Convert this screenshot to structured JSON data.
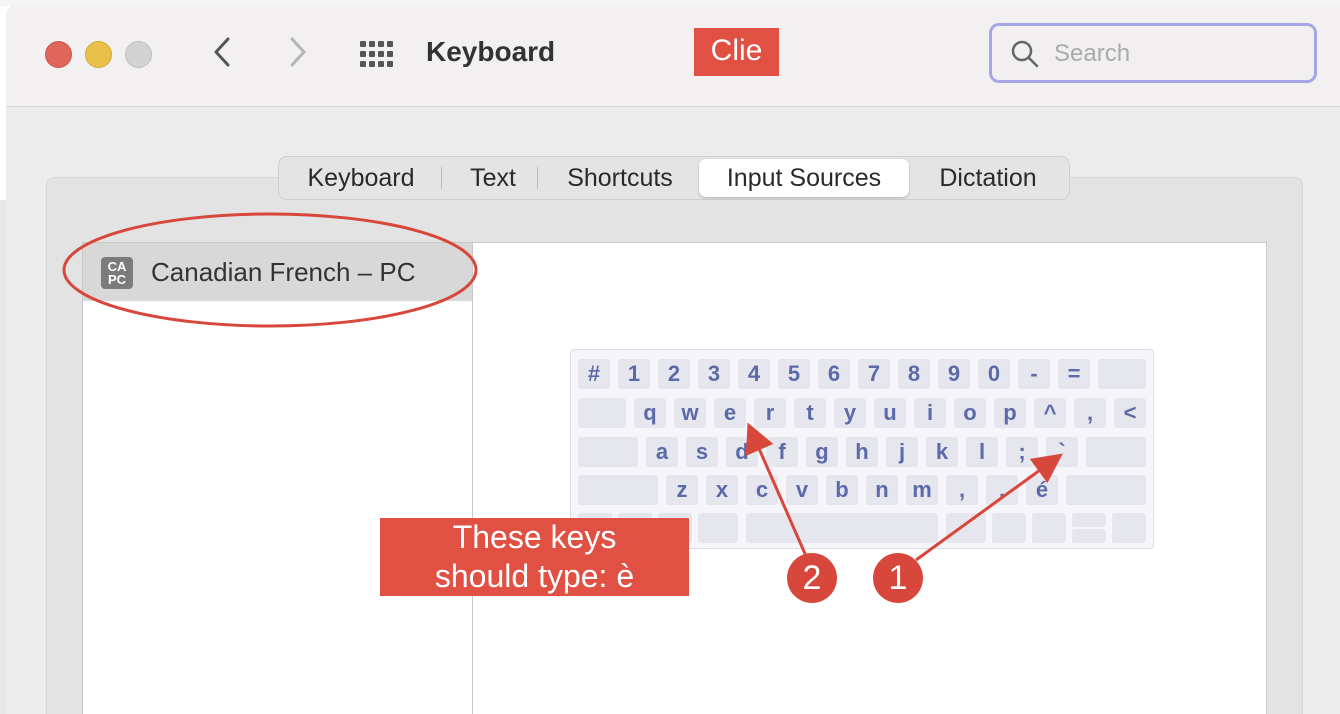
{
  "window": {
    "title": "Keyboard",
    "traffic_lights": [
      "close-button",
      "minimize-button",
      "zoom-button"
    ]
  },
  "toolbar": {
    "back_icon": "chevron-left-icon",
    "forward_icon": "chevron-right-icon",
    "grid_icon": "show-all-grid-icon"
  },
  "search": {
    "placeholder": "Search",
    "value": ""
  },
  "tabs": [
    {
      "label": "Keyboard",
      "active": false
    },
    {
      "label": "Text",
      "active": false
    },
    {
      "label": "Shortcuts",
      "active": false
    },
    {
      "label": "Input Sources",
      "active": true
    },
    {
      "label": "Dictation",
      "active": false
    }
  ],
  "input_sources": [
    {
      "badge_top": "CA",
      "badge_bottom": "PC",
      "label": "Canadian French – PC",
      "selected": true
    }
  ],
  "keyboard": {
    "row1": [
      "#",
      "1",
      "2",
      "3",
      "4",
      "5",
      "6",
      "7",
      "8",
      "9",
      "0",
      "-",
      "="
    ],
    "row2": [
      "q",
      "w",
      "e",
      "r",
      "t",
      "y",
      "u",
      "i",
      "o",
      "p",
      "^",
      ",",
      "<"
    ],
    "row3": [
      "a",
      "s",
      "d",
      "f",
      "g",
      "h",
      "j",
      "k",
      "l",
      ";",
      "`"
    ],
    "row4": [
      "z",
      "x",
      "c",
      "v",
      "b",
      "n",
      "m",
      ",",
      ".",
      "é"
    ]
  },
  "annotations": {
    "top_callout": "Clie",
    "callout_line1": "These keys",
    "callout_line2": "should type: è",
    "marker_1": "1",
    "marker_2": "2",
    "annotation_color": "#e15143"
  }
}
